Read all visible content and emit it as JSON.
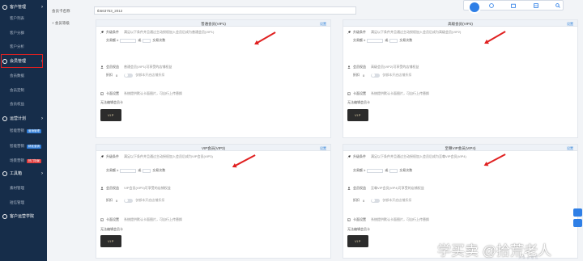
{
  "sidebar": {
    "groups": [
      {
        "label": "客户管理",
        "items": [
          "客户列表",
          "客户分群",
          "客户分析"
        ]
      },
      {
        "label": "会员管理",
        "items": [
          "会员数据",
          "会员定制",
          "会员权益"
        ]
      },
      {
        "label": "运营计划",
        "items": [
          {
            "label": "智能营销",
            "tag": "营销管理",
            "tag_color": "#2e7bd6"
          },
          {
            "label": "智能营销",
            "tag": "精准营销",
            "tag_color": "#2e7bd6"
          },
          {
            "label": "场景营销",
            "tag": "热门场景",
            "tag_color": "#e23c3c"
          }
        ]
      },
      {
        "label": "工具箱",
        "items": [
          "素材管理",
          "短信管理"
        ]
      },
      {
        "label": "客户运营学院",
        "items": []
      }
    ]
  },
  "form": {
    "card_name_label": "会员卡名称",
    "card_name_value": "tb563753_2012",
    "level_label": "+ 会员等级"
  },
  "cards": [
    {
      "title": "普通会员(VIP1)",
      "settings": "设置",
      "upgrade_label": "升级条件",
      "upgrade_desc": "满足以下条件并且通过主动授权加入会员后成为普通会员(VIP1)",
      "trade_label": "交易额 ≥",
      "trade_or": "或",
      "trade_count": "交易次数",
      "rights_label": "会员权益",
      "rights_desc": "普通会员(VIP1)可享受的店铺权益",
      "discount_label": "折扣",
      "discount_value": "0",
      "discount_desc": "仅够本开启店铺折扣",
      "card_label": "卡面设置",
      "card_desc": "系统提供默认卡面图片，可自行上传替换",
      "card_name": "无法编辑会员卡",
      "vip": "VIP"
    },
    {
      "title": "高级会员(VIP2)",
      "settings": "设置",
      "upgrade_label": "升级条件",
      "upgrade_desc": "满足以下条件并且通过主动授权加入会员后成为高级会员(VIP2)",
      "trade_label": "交易额 ≥",
      "trade_or": "或",
      "trade_count": "交易次数",
      "rights_label": "会员权益",
      "rights_desc": "高级会员(VIP2)可享受的店铺权益",
      "discount_label": "折扣",
      "discount_value": "0",
      "discount_desc": "仅够本开启店铺折扣",
      "card_label": "卡面设置",
      "card_desc": "系统提供默认卡面图片，可自行上传替换",
      "card_name": "无法编辑会员卡",
      "vip": "VIP"
    },
    {
      "title": "VIP会员(VIP3)",
      "settings": "设置",
      "upgrade_label": "升级条件",
      "upgrade_desc": "满足以下条件并且通过主动授权加入会员后成为VIP会员(VIP3)",
      "trade_label": "交易额 ≥",
      "trade_or": "或",
      "trade_count": "交易次数",
      "rights_label": "会员权益",
      "rights_desc": "VIP会员(VIP3)可享受的店铺权益",
      "discount_label": "折扣",
      "discount_value": "0",
      "discount_desc": "仅够本开启店铺折扣",
      "card_label": "卡面设置",
      "card_desc": "系统提供默认卡面图片，可自行上传替换",
      "card_name": "无法编辑会员卡",
      "vip": "VIP"
    },
    {
      "title": "至尊VIP会员(VIP4)",
      "settings": "设置",
      "upgrade_label": "升级条件",
      "upgrade_desc": "满足以下条件并且通过主动授权加入会员后成为至尊VIP会员(VIP4)",
      "trade_label": "交易额 ≥",
      "trade_or": "或",
      "trade_count": "交易次数",
      "rights_label": "会员权益",
      "rights_desc": "至尊VIP会员(VIP4)可享受的店铺权益",
      "discount_label": "折扣",
      "discount_value": "0",
      "discount_desc": "仅够本开启店铺折扣",
      "card_label": "卡面设置",
      "card_desc": "系统提供默认卡面图片，可自行上传替换",
      "card_name": "无法编辑会员卡",
      "vip": "VIP"
    }
  ],
  "watermark": "学买卖 @拾荒老人",
  "watermark_sub": "头 条 @ 拾 荒",
  "colors": {
    "sidebar": "#162d4a",
    "accent": "#2b7fd8",
    "highlight": "#e02020"
  }
}
